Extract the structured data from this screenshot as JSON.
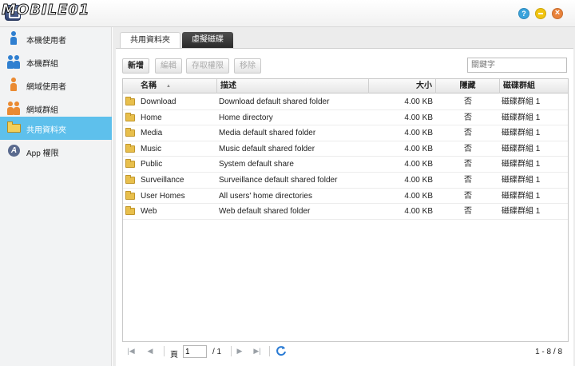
{
  "window": {
    "logo_text": "MOBILE01",
    "help_icon": "help-icon",
    "minimize_icon": "minimize-icon",
    "close_icon": "close-icon"
  },
  "sidebar": {
    "items": [
      {
        "label": "本機使用者",
        "icon": "local-user-icon",
        "active": false
      },
      {
        "label": "本機群組",
        "icon": "local-group-icon",
        "active": false
      },
      {
        "label": "網域使用者",
        "icon": "domain-user-icon",
        "active": false
      },
      {
        "label": "網域群組",
        "icon": "domain-group-icon",
        "active": false
      },
      {
        "label": "共用資料夾",
        "icon": "shared-folder-icon",
        "active": true
      },
      {
        "label": "App 權限",
        "icon": "app-permission-icon",
        "active": false
      }
    ],
    "active_color": "#5ec0ec"
  },
  "tabs": [
    {
      "label": "共用資料夾",
      "active": true
    },
    {
      "label": "虛擬磁碟",
      "active": false
    }
  ],
  "toolbar": {
    "create_label": "新增",
    "edit_label": "編輯",
    "access_label": "存取權限",
    "remove_label": "移除",
    "search_placeholder": "關鍵字"
  },
  "table": {
    "columns": [
      "名稱",
      "描述",
      "大小",
      "隱藏",
      "磁碟群組"
    ],
    "rows": [
      {
        "name": "Download",
        "description": "Download default shared folder",
        "size": "4.00 KB",
        "hidden": "否",
        "volume": "磁碟群組 1"
      },
      {
        "name": "Home",
        "description": "Home directory",
        "size": "4.00 KB",
        "hidden": "否",
        "volume": "磁碟群組 1"
      },
      {
        "name": "Media",
        "description": "Media default shared folder",
        "size": "4.00 KB",
        "hidden": "否",
        "volume": "磁碟群組 1"
      },
      {
        "name": "Music",
        "description": "Music default shared folder",
        "size": "4.00 KB",
        "hidden": "否",
        "volume": "磁碟群組 1"
      },
      {
        "name": "Public",
        "description": "System default share",
        "size": "4.00 KB",
        "hidden": "否",
        "volume": "磁碟群組 1"
      },
      {
        "name": "Surveillance",
        "description": "Surveillance default shared folder",
        "size": "4.00 KB",
        "hidden": "否",
        "volume": "磁碟群組 1"
      },
      {
        "name": "User Homes",
        "description": "All users' home directories",
        "size": "4.00 KB",
        "hidden": "否",
        "volume": "磁碟群組 1"
      },
      {
        "name": "Web",
        "description": "Web default shared folder",
        "size": "4.00 KB",
        "hidden": "否",
        "volume": "磁碟群組 1"
      }
    ]
  },
  "pager": {
    "page_label": "頁",
    "current_page": "1",
    "total_pages": "/ 1",
    "range_text": "1 - 8 / 8"
  }
}
